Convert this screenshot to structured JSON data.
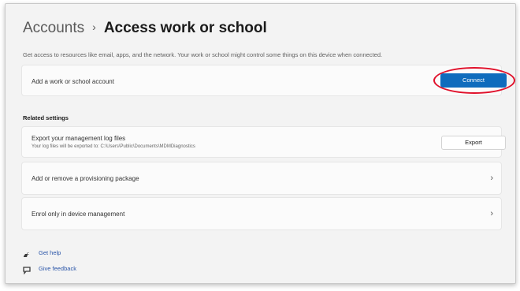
{
  "header": {
    "parent": "Accounts",
    "separator": "›",
    "title": "Access work or school"
  },
  "description": "Get access to resources like email, apps, and the network. Your work or school might control some things on this device when connected.",
  "add_account": {
    "label": "Add a work or school account",
    "button_label": "Connect"
  },
  "related_settings": {
    "heading": "Related settings",
    "export": {
      "label": "Export your management log files",
      "sublabel": "Your log files will be exported to: C:\\Users\\Public\\Documents\\MDMDiagnostics",
      "button_label": "Export"
    },
    "provisioning": {
      "label": "Add or remove a provisioning package",
      "chevron": "›"
    },
    "enrol": {
      "label": "Enrol only in device management",
      "chevron": "›"
    }
  },
  "links": {
    "get_help": "Get help",
    "give_feedback": "Give feedback"
  },
  "colors": {
    "accent": "#0f6cbd",
    "highlight": "#e0102a",
    "link": "#2a55a8"
  }
}
